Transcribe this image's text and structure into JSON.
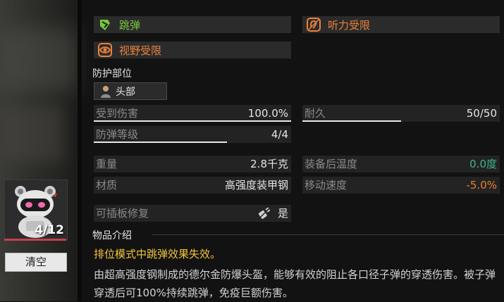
{
  "traits": {
    "ricochet": {
      "label": "跳弹",
      "icon": "ricochet-shield-icon",
      "color": "#76c93a"
    },
    "hearing": {
      "label": "听力受限",
      "icon": "ear-restricted-icon",
      "color": "#e9813c"
    },
    "vision": {
      "label": "视野受限",
      "icon": "eye-restricted-icon",
      "color": "#e9813c"
    }
  },
  "protection": {
    "title": "防护部位",
    "part_label": "头部",
    "part_icon": "head-silhouette-icon"
  },
  "stats": {
    "damage_taken": {
      "label": "受到伤害",
      "value": "100.0%",
      "fill": 1.0
    },
    "durability": {
      "label": "耐久",
      "value": "50/50",
      "fill": 0.5
    },
    "protection_level": {
      "label": "防弹等级",
      "value": "4/4",
      "fill": 0.675
    },
    "weight": {
      "label": "重量",
      "value": "2.8千克"
    },
    "temperature": {
      "label": "装备后温度",
      "value": "0.0度",
      "color": "#3fb58c"
    },
    "material": {
      "label": "材质",
      "value": "高强度装甲钢"
    },
    "move_speed": {
      "label": "移动速度",
      "value": "-5.0%",
      "color": "#ee7b2f"
    },
    "plate_repair": {
      "label": "可插板修复",
      "value": "是",
      "icon": "plug-icon"
    }
  },
  "description": {
    "title": "物品介绍",
    "highlight": "排位模式中跳弹效果失效。",
    "body": "由超高强度钢制成的德尔金防爆头盔，能够有效的阻止各口径子弹的穿透伤害。被子弹穿透后可100%持续跳弹，免疫巨额伤害。"
  },
  "character": {
    "count": "4/12",
    "avatar_icon": "robot-avatar-icon",
    "clear_label": "清空"
  }
}
